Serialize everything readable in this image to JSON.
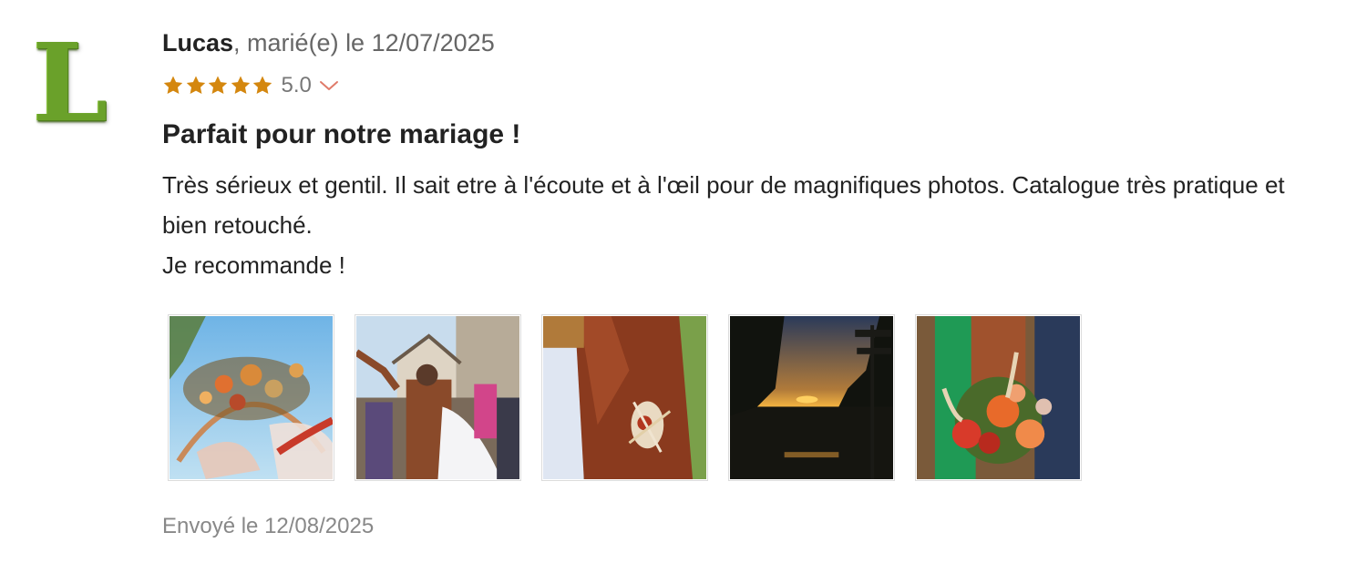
{
  "review": {
    "avatar_letter": "L",
    "author_name": "Lucas",
    "author_meta": ", marié(e) le 12/07/2025",
    "rating": {
      "stars": 5,
      "value": "5.0",
      "star_color": "#d4870f",
      "chevron_color": "#e07b6a"
    },
    "title": "Parfait pour notre mariage !",
    "body_lines": [
      "Très sérieux et gentil. Il sait etre à l'écoute et à l'œil pour de magnifiques photos. Catalogue très pratique et bien retouché.",
      "Je recommande !"
    ],
    "photos": [
      {
        "icon": "flower-arch-photo"
      },
      {
        "icon": "ceremony-exit-photo"
      },
      {
        "icon": "groom-boutonniere-photo"
      },
      {
        "icon": "sunset-photo"
      },
      {
        "icon": "bouquet-photo"
      }
    ],
    "sent_date": "Envoyé le 12/08/2025"
  }
}
